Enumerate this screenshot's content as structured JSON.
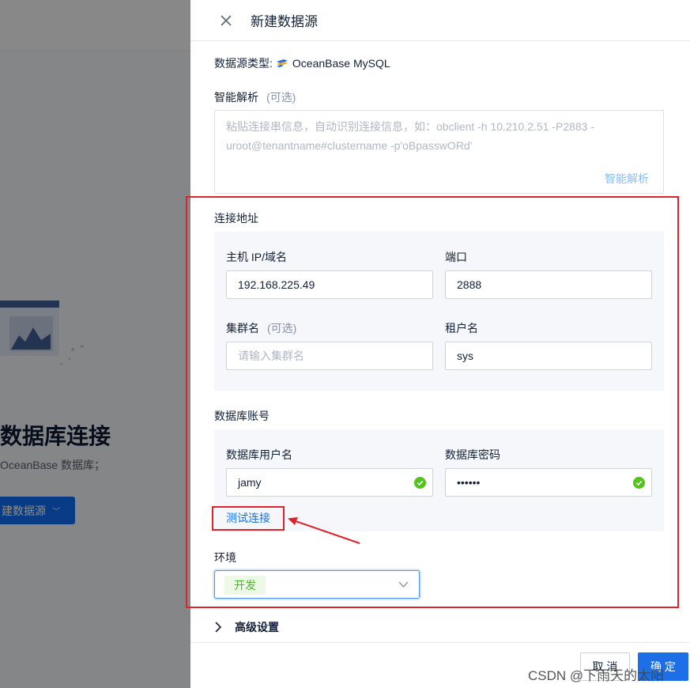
{
  "background": {
    "title": "数据库连接",
    "subtitle": "OceanBase 数据库；",
    "button_label": "建数据源"
  },
  "drawer": {
    "title": "新建数据源",
    "type_label": "数据源类型:",
    "type_value": "OceanBase MySQL",
    "smart_label": "智能解析",
    "optional": "(可选)",
    "smart_placeholder": "粘贴连接串信息，自动识别连接信息，如：obclient -h 10.210.2.51 -P2883 -uroot@tenantname#clustername -p'oBpasswORd'",
    "smart_button": "智能解析",
    "address_section": "连接地址",
    "host_label": "主机 IP/域名",
    "host_value": "192.168.225.49",
    "port_label": "端口",
    "port_value": "2888",
    "cluster_label": "集群名",
    "cluster_placeholder": "请输入集群名",
    "tenant_label": "租户名",
    "tenant_value": "sys",
    "account_section": "数据库账号",
    "user_label": "数据库用户名",
    "user_value": "jamy",
    "password_label": "数据库密码",
    "password_value": "••••••",
    "test_link": "测试连接",
    "env_label": "环境",
    "env_value": "开发",
    "advanced_label": "高级设置",
    "cancel_button": "取 消",
    "confirm_button": "确 定"
  },
  "watermark": "CSDN @下雨天的太阳",
  "colors": {
    "primary": "#1c6fe6",
    "annotation_red": "#e0222a",
    "success_green": "#52c41a",
    "env_tag_bg": "#ecf9e6"
  }
}
